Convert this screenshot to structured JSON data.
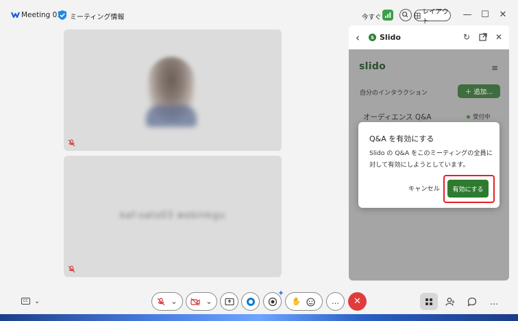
{
  "titlebar": {
    "app_title": "Meeting 01",
    "meeting_info": "ミーティング情報",
    "now": "今すぐ",
    "layout_label": "レイアウト",
    "minimize": "—",
    "maximize": "☐",
    "close": "✕"
  },
  "tiles": {
    "participant2_name": "kaf-sato03 webinkgu"
  },
  "slido_panel": {
    "title": "Slido",
    "back": "‹",
    "logo": "slido",
    "menu": "≡",
    "my_interactions": "自分のインタラクション",
    "add_button": "＋ 追加...",
    "qa_title": "オーディエンス Q&A",
    "qa_status": "受付中"
  },
  "dialog": {
    "title": "Q&A を有効にする",
    "body": "Slido の Q&A をこのミーティングの全員に対して有効にしようとしています。",
    "cancel": "キャンセル",
    "enable": "有効にする"
  },
  "toolbar": {
    "more": "…",
    "end": "✕"
  },
  "colors": {
    "accent_green": "#2e7b30",
    "end_call_red": "#e03c3c",
    "highlight_red": "#e61f1f"
  }
}
